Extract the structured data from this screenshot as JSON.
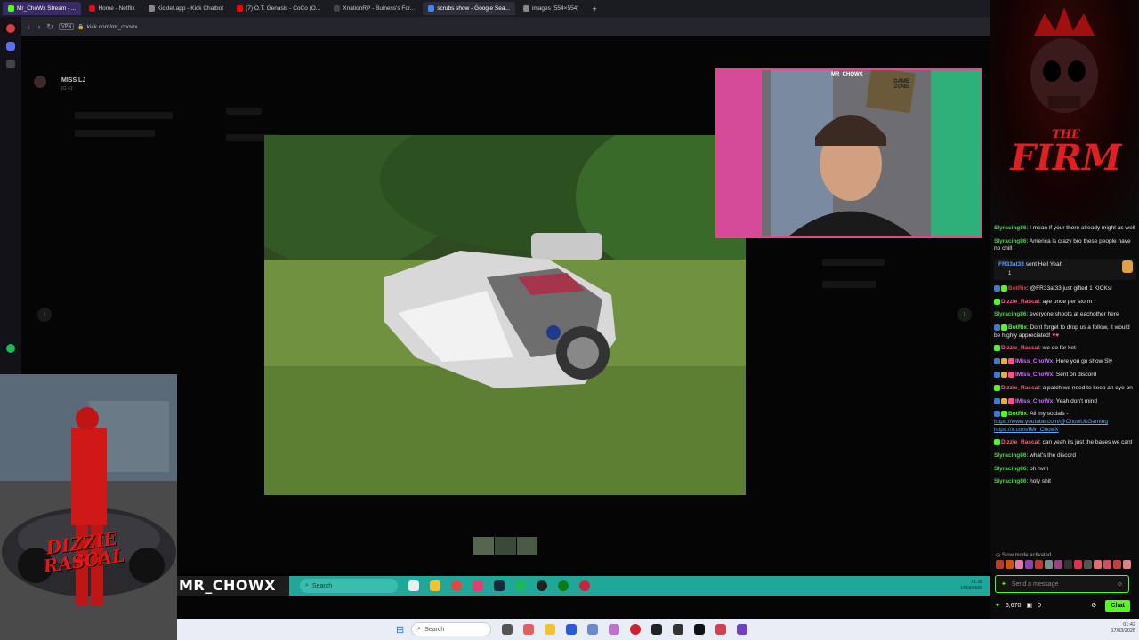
{
  "browser": {
    "tabs": [
      {
        "label": "Mr_ChoWx Stream - ...",
        "color": "#53fc18",
        "active": true
      },
      {
        "label": "Home - Netflix",
        "color": "#e50914",
        "active": false
      },
      {
        "label": "Kicklet.app - Kick Chatbot",
        "color": "#888888",
        "active": false
      },
      {
        "label": "(7) O.T. Genasis - CoCo (O...",
        "color": "#ff0000",
        "active": false
      },
      {
        "label": "XnationRP - Buiness's For...",
        "color": "#444444",
        "active": false
      },
      {
        "label": "scrubs show - Google Sea...",
        "color": "#4285f4",
        "active": false
      },
      {
        "label": "images (554×554)",
        "color": "#888888",
        "active": false
      }
    ],
    "new_tab": "+",
    "url": "kick.com/mr_chowx",
    "vpn": "VPN"
  },
  "stream": {
    "dm_name": "MISS LJ",
    "dm_time": "01:41",
    "overlay_name": "MR_CHOWX",
    "gta_text": "DIZZIE RASCAL",
    "cam_label": "MR_CHOWX",
    "cam_sign": "GAME ZONE",
    "overlay_search": "Search",
    "overlay_time": "01:38",
    "overlay_date": "17/03/2026"
  },
  "firm": {
    "line1": "THE",
    "line2": "FIRM"
  },
  "chat": {
    "messages": [
      {
        "user": "Slyracing86",
        "color": "#4fd14f",
        "text": "I mean if your there already might as well",
        "badges": []
      },
      {
        "user": "Slyracing86",
        "color": "#4fd14f",
        "text": "America is crazy bro these people have no chill",
        "badges": []
      },
      {
        "user": "FR33at33",
        "color": "#5aa0ff",
        "text": "sent Hell Yeah",
        "badges": []
      },
      {
        "user": "BotRix",
        "color": "#e03a3a",
        "text": "@FR33at33 just gifted 1 KICKs!",
        "badges": [
          "#3a7bd5",
          "#53fc18"
        ]
      },
      {
        "user": "Dizzie_Rascal",
        "color": "#ff5e7e",
        "text": "aye once per storm",
        "badges": [
          "#53fc18"
        ]
      },
      {
        "user": "Slyracing86",
        "color": "#4fd14f",
        "text": "everyone shoots at eachother here",
        "badges": []
      },
      {
        "user": "BotRix",
        "color": "#53fc18",
        "text": "Dont forget to drop us a follow, it would be highly appreciated!",
        "badges": [
          "#3a7bd5",
          "#53fc18"
        ]
      },
      {
        "user": "Dizzie_Rascal",
        "color": "#ff5e7e",
        "text": "we do for ket",
        "badges": [
          "#53fc18"
        ]
      },
      {
        "user": "IMiss_ChoWx",
        "color": "#c86bff",
        "text": "Here you go show Sly",
        "badges": [
          "#3a7bd5",
          "#e0b030",
          "#ff4d8d"
        ]
      },
      {
        "user": "IMiss_ChoWx",
        "color": "#c86bff",
        "text": "Sent on discord",
        "badges": [
          "#3a7bd5",
          "#e0b030",
          "#ff4d8d"
        ]
      },
      {
        "user": "Dizzie_Rascal",
        "color": "#ff5e7e",
        "text": "a patch we need to keep an eye on",
        "badges": [
          "#53fc18"
        ]
      },
      {
        "user": "IMiss_ChoWx",
        "color": "#c86bff",
        "text": "Yeah don't mind",
        "badges": [
          "#3a7bd5",
          "#e0b030",
          "#ff4d8d"
        ]
      },
      {
        "user": "BotRix",
        "color": "#53fc18",
        "text": "All my socials -",
        "badges": [
          "#3a7bd5",
          "#53fc18"
        ]
      },
      {
        "user": "Dizzie_Rascal",
        "color": "#ff5e7e",
        "text": "can yeah its just the bases we cant",
        "badges": [
          "#53fc18"
        ]
      },
      {
        "user": "Slyracing86",
        "color": "#4fd14f",
        "text": "what's the discord",
        "badges": []
      },
      {
        "user": "Slyracing86",
        "color": "#4fd14f",
        "text": "oh nvm",
        "badges": []
      },
      {
        "user": "Slyracing86",
        "color": "#4fd14f",
        "text": "holy shit",
        "badges": []
      }
    ],
    "links": [
      "https://www.youtube.com/@ChowUkGaming",
      "https://x.com/IMr_ChowX"
    ],
    "gift_count": "1",
    "slow_mode": "Slow mode activated",
    "input_placeholder": "Send a message",
    "points": "6,670",
    "gifts": "0",
    "chat_button": "Chat"
  },
  "taskbar": {
    "search": "Search",
    "time": "01:42",
    "date": "17/03/2026"
  },
  "colors": {
    "kick_green": "#53fc18",
    "overlay_teal": "#1fa89a",
    "firm_red": "#e02020"
  }
}
